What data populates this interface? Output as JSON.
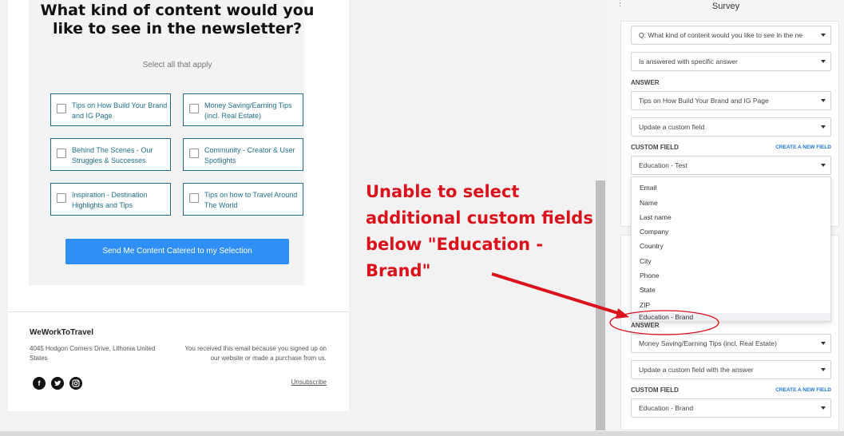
{
  "email": {
    "headline": "What kind of content would you like to see in the newsletter?",
    "subhead": "Select all that apply",
    "options": [
      "Tips on How Build Your Brand and IG Page",
      "Money Saving/Earning Tips (incl. Real Estate)",
      "Behind The Scenes - Our Struggles & Successes",
      "Community - Creator & User Spotlights",
      "Inspiration - Destination Highlights and Tips",
      "Tips on how to Travel Around The World"
    ],
    "cta": "Send Me Content Catered to my Selection",
    "footer": {
      "brand": "WeWorkToTravel",
      "address": "4045 Hodgon Corners Drive, Lithonia United States",
      "notice": "You received this email because you signed up on our website or made a purchase from us.",
      "unsubscribe": "Unsubscribe",
      "social": [
        "facebook-icon",
        "twitter-icon",
        "instagram-icon"
      ]
    }
  },
  "annotation": {
    "text": "Unable to select additional custom fields below \"Education - Brand\"",
    "color": "#d9121b"
  },
  "panel": {
    "title": "Survey",
    "card1": {
      "question": "Q: What kind of content would you like to see in the ne",
      "condition": "Is answered with specific answer",
      "answer_label": "ANSWER",
      "answer": "Tips on How Build Your Brand and IG Page",
      "action": "Update a custom field",
      "custom_field_label": "CUSTOM FIELD",
      "create_link": "CREATE A NEW FIELD",
      "custom_field": "Education - Test"
    },
    "dropdown_options": [
      "Email",
      "Name",
      "Last name",
      "Company",
      "Country",
      "City",
      "Phone",
      "State",
      "ZIP",
      "Education - Brand"
    ],
    "card2": {
      "answer_label": "ANSWER",
      "answer": "Money Saving/Earning Tips (incl. Real Estate)",
      "action": "Update a custom field with the answer",
      "custom_field_label": "CUSTOM FIELD",
      "create_link": "CREATE A NEW FIELD",
      "custom_field": "Education - Brand"
    }
  },
  "colors": {
    "accent": "#2f8ff5",
    "option_border": "#1f6f8b",
    "link": "#1d74d6"
  }
}
